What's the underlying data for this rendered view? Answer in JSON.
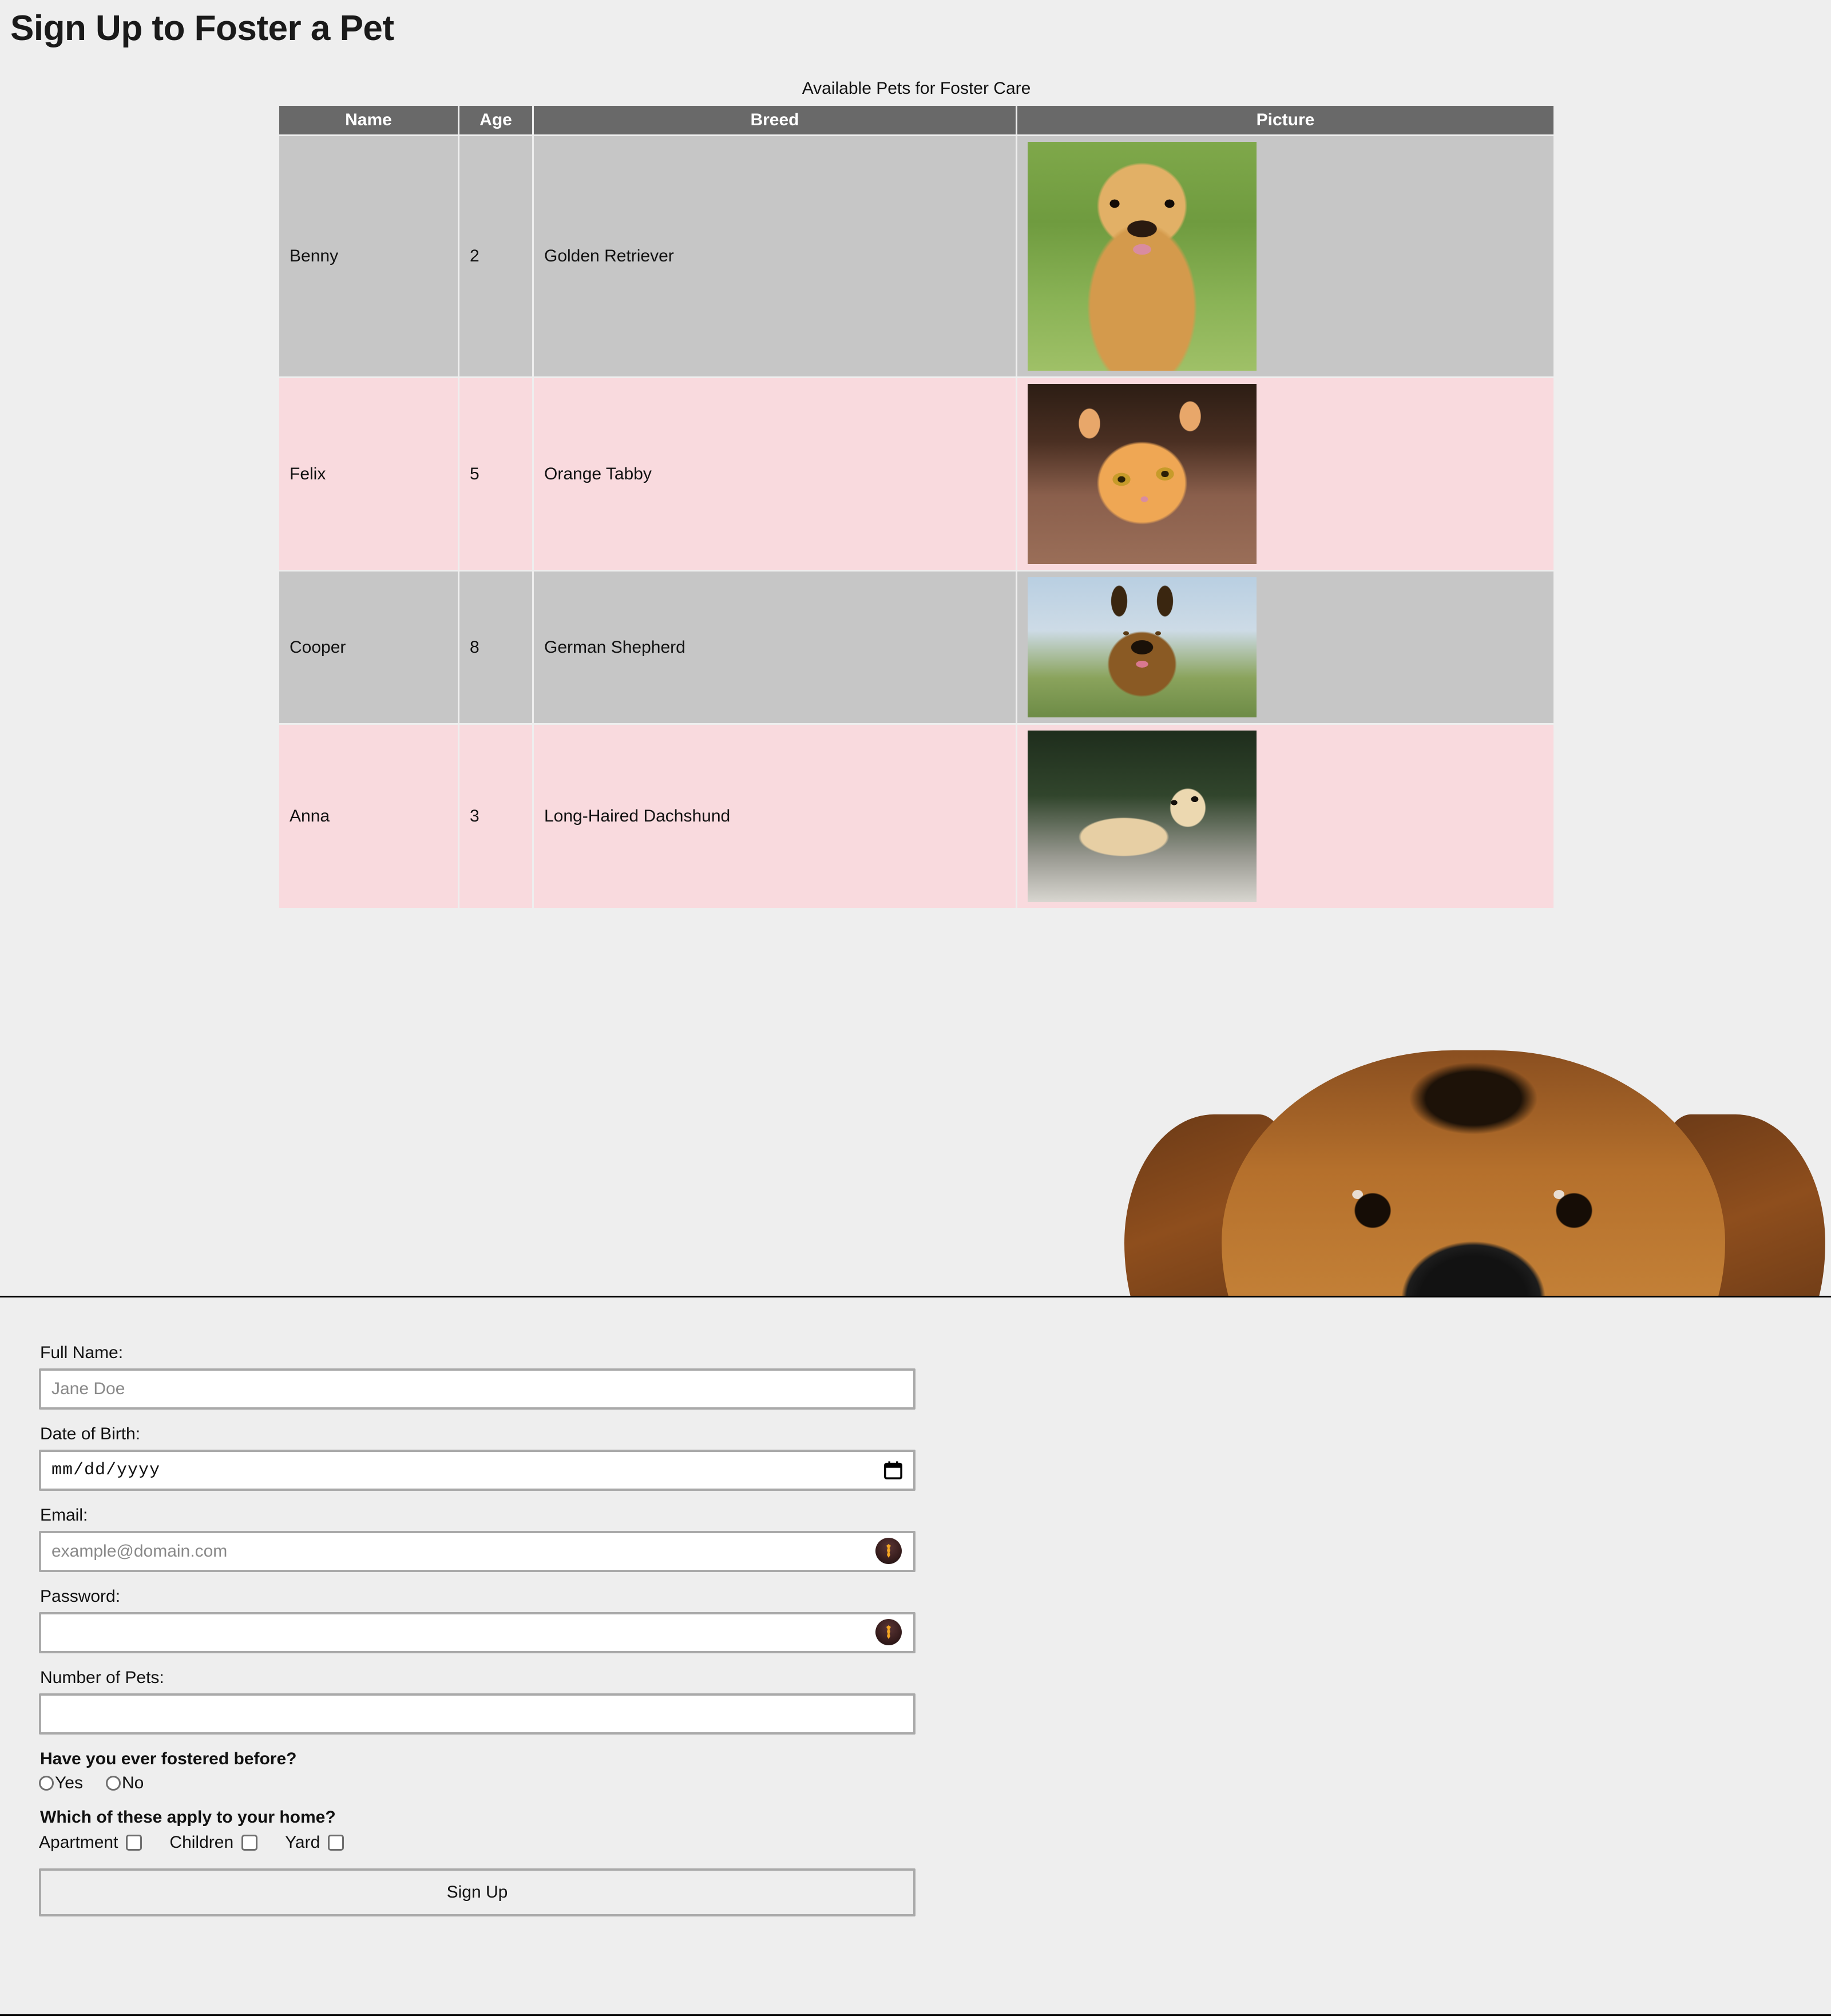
{
  "page": {
    "title": "Sign Up to Foster a Pet",
    "background_color": "#eeeeee"
  },
  "pets_table": {
    "caption": "Available Pets for Foster Care",
    "header_bg": "#696969",
    "row_colors": [
      "#c6c6c6",
      "#f9dade"
    ],
    "columns": [
      "Name",
      "Age",
      "Breed",
      "Picture"
    ],
    "rows": [
      {
        "name": "Benny",
        "age": "2",
        "breed": "Golden Retriever",
        "picture": "golden-retriever-photo"
      },
      {
        "name": "Felix",
        "age": "5",
        "breed": "Orange Tabby",
        "picture": "orange-tabby-kitten-photo"
      },
      {
        "name": "Cooper",
        "age": "8",
        "breed": "German Shepherd",
        "picture": "german-shepherd-photo"
      },
      {
        "name": "Anna",
        "age": "3",
        "breed": "Long-Haired Dachshund",
        "picture": "long-haired-dachshund-photo"
      }
    ]
  },
  "hero": {
    "image": "dachshund-face-peeking-photo"
  },
  "form": {
    "full_name": {
      "label": "Full Name:",
      "placeholder": "Jane Doe",
      "value": ""
    },
    "date_of_birth": {
      "label": "Date of Birth:",
      "value": "mm/dd/yyyy",
      "icon": "calendar-icon"
    },
    "email": {
      "label": "Email:",
      "placeholder": "example@domain.com",
      "value": "",
      "icon": "key-autofill-icon"
    },
    "password": {
      "label": "Password:",
      "placeholder": "",
      "value": "",
      "icon": "key-autofill-icon"
    },
    "number_of_pets": {
      "label": "Number of Pets:",
      "placeholder": "",
      "value": ""
    },
    "fostered_before": {
      "question": "Have you ever fostered before?",
      "options": [
        {
          "label": "Yes",
          "checked": false
        },
        {
          "label": "No",
          "checked": false
        }
      ]
    },
    "home_features": {
      "question": "Which of these apply to your home?",
      "options": [
        {
          "label": "Apartment",
          "checked": false
        },
        {
          "label": "Children",
          "checked": false
        },
        {
          "label": "Yard",
          "checked": false
        }
      ]
    },
    "submit_label": "Sign Up"
  }
}
